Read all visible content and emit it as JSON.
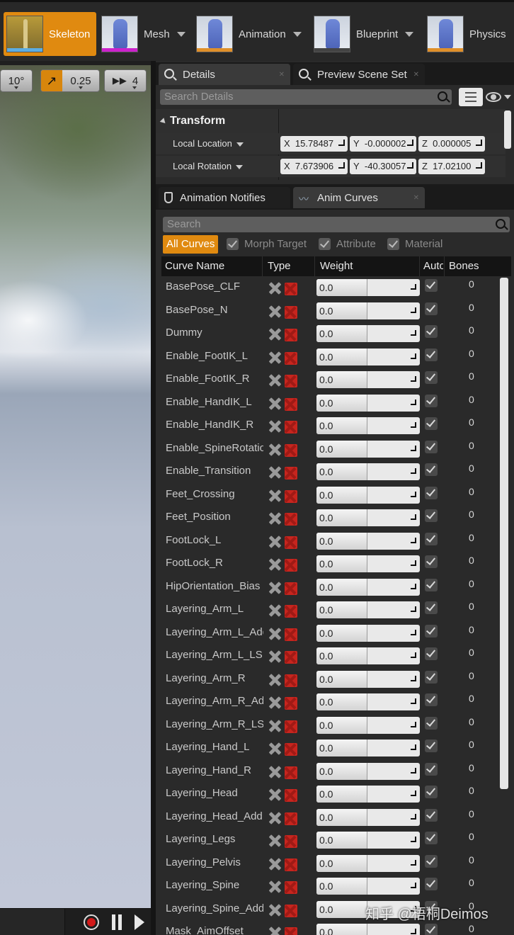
{
  "toolbar": {
    "modes": [
      {
        "label": "Skeleton",
        "active": true,
        "bar": "#5dade2"
      },
      {
        "label": "Mesh",
        "active": false,
        "bar": "#cc22cc"
      },
      {
        "label": "Animation",
        "active": false,
        "bar": "#e0902a"
      },
      {
        "label": "Blueprint",
        "active": false,
        "bar": "#444444"
      },
      {
        "label": "Physics",
        "active": false,
        "bar": "#e0902a"
      }
    ]
  },
  "viewport": {
    "rotation_snap": "10°",
    "scale_snap": "0.25",
    "camera_speed": "4"
  },
  "details_panel": {
    "tabs": [
      "Details",
      "Preview Scene Set"
    ],
    "search_placeholder": "Search Details",
    "section": "Transform",
    "location": {
      "label": "Local Location",
      "x": "15.78487",
      "y": "-0.000002",
      "z": "0.000005"
    },
    "rotation": {
      "label": "Local Rotation",
      "x": "7.673906",
      "y": "-40.30057",
      "z": "17.02100"
    }
  },
  "curves_panel": {
    "tabs": [
      "Animation Notifies",
      "Anim Curves"
    ],
    "search_placeholder": "Search",
    "filters": {
      "all": "All Curves",
      "morph": "Morph Target",
      "attribute": "Attribute",
      "material": "Material"
    },
    "columns": {
      "name": "Curve Name",
      "type": "Type",
      "weight": "Weight",
      "auto": "Auto",
      "bones": "Bones"
    },
    "rows": [
      {
        "name": "BasePose_CLF",
        "weight": "0.0",
        "bones": "0"
      },
      {
        "name": "BasePose_N",
        "weight": "0.0",
        "bones": "0"
      },
      {
        "name": "Dummy",
        "weight": "0.0",
        "bones": "0"
      },
      {
        "name": "Enable_FootIK_L",
        "weight": "0.0",
        "bones": "0"
      },
      {
        "name": "Enable_FootIK_R",
        "weight": "0.0",
        "bones": "0"
      },
      {
        "name": "Enable_HandIK_L",
        "weight": "0.0",
        "bones": "0"
      },
      {
        "name": "Enable_HandIK_R",
        "weight": "0.0",
        "bones": "0"
      },
      {
        "name": "Enable_SpineRotation",
        "weight": "0.0",
        "bones": "0"
      },
      {
        "name": "Enable_Transition",
        "weight": "0.0",
        "bones": "0"
      },
      {
        "name": "Feet_Crossing",
        "weight": "0.0",
        "bones": "0"
      },
      {
        "name": "Feet_Position",
        "weight": "0.0",
        "bones": "0"
      },
      {
        "name": "FootLock_L",
        "weight": "0.0",
        "bones": "0"
      },
      {
        "name": "FootLock_R",
        "weight": "0.0",
        "bones": "0"
      },
      {
        "name": "HipOrientation_Bias",
        "weight": "0.0",
        "bones": "0"
      },
      {
        "name": "Layering_Arm_L",
        "weight": "0.0",
        "bones": "0"
      },
      {
        "name": "Layering_Arm_L_Add",
        "weight": "0.0",
        "bones": "0"
      },
      {
        "name": "Layering_Arm_L_LS",
        "weight": "0.0",
        "bones": "0"
      },
      {
        "name": "Layering_Arm_R",
        "weight": "0.0",
        "bones": "0"
      },
      {
        "name": "Layering_Arm_R_Add",
        "weight": "0.0",
        "bones": "0"
      },
      {
        "name": "Layering_Arm_R_LS",
        "weight": "0.0",
        "bones": "0"
      },
      {
        "name": "Layering_Hand_L",
        "weight": "0.0",
        "bones": "0"
      },
      {
        "name": "Layering_Hand_R",
        "weight": "0.0",
        "bones": "0"
      },
      {
        "name": "Layering_Head",
        "weight": "0.0",
        "bones": "0"
      },
      {
        "name": "Layering_Head_Add",
        "weight": "0.0",
        "bones": "0"
      },
      {
        "name": "Layering_Legs",
        "weight": "0.0",
        "bones": "0"
      },
      {
        "name": "Layering_Pelvis",
        "weight": "0.0",
        "bones": "0"
      },
      {
        "name": "Layering_Spine",
        "weight": "0.0",
        "bones": "0"
      },
      {
        "name": "Layering_Spine_Add",
        "weight": "0.0",
        "bones": "0"
      },
      {
        "name": "Mask_AimOffset",
        "weight": "0.0",
        "bones": "0"
      }
    ]
  },
  "watermark": "知乎 @梧桐Deimos"
}
